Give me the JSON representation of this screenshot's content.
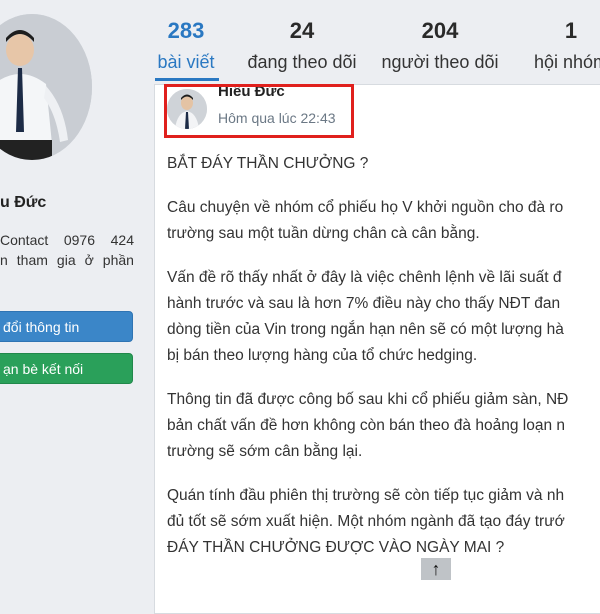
{
  "profile": {
    "name": "u Đức",
    "bio_line1": [
      "Contact",
      "0976",
      "424"
    ],
    "bio_line2": [
      "n",
      "tham",
      "gia",
      "ở",
      "phần"
    ],
    "edit_button": "đổi thông tin",
    "friends_button": "ạn bè kết nối"
  },
  "stats": [
    {
      "value": "283",
      "label": "bài viết"
    },
    {
      "value": "24",
      "label": "đang theo dõi"
    },
    {
      "value": "204",
      "label": "người theo dõi"
    },
    {
      "value": "1",
      "label": "hội nhóm"
    }
  ],
  "post": {
    "author": "Hiếu Đức",
    "time": "Hôm qua lúc 22:43",
    "paragraphs": [
      [
        "BẮT ĐÁY THẦN CHƯỞNG ?"
      ],
      [
        "Câu chuyện về nhóm cổ phiếu họ V khởi nguồn cho đà ro",
        "trường sau một tuần dừng chân cà cân bằng."
      ],
      [
        "Vấn đề rõ thấy nhất ở đây là việc chênh lệnh về lãi suất đ",
        "hành trước và sau là hơn 7% điều này cho thấy NĐT đan",
        "dòng tiền của Vin trong ngắn hạn nên sẽ có một lượng hà",
        "bị bán theo lượng hàng của tổ chức hedging."
      ],
      [
        "Thông tin đã được công bố sau khi cổ phiếu giảm sàn, NĐ",
        "bản chất vấn đề hơn không còn bán theo đà hoảng loạn n",
        "trường sẽ sớm cân bằng lại."
      ],
      [
        "Quán tính đầu phiên thị trường sẽ còn tiếp tục giảm và nh",
        "đủ tốt sẽ sớm xuất hiện. Một nhóm ngành đã tạo đáy trướ",
        "ĐÁY THẦN CHƯỞNG ĐƯỢC VÀO NGÀY MAI ?"
      ]
    ]
  },
  "colors": {
    "accent": "#2a78c2",
    "highlight": "#e0201d",
    "button_blue": "#3b86c8",
    "button_green": "#2aa05a"
  },
  "icons": {
    "scroll": "arrow-up-icon"
  }
}
